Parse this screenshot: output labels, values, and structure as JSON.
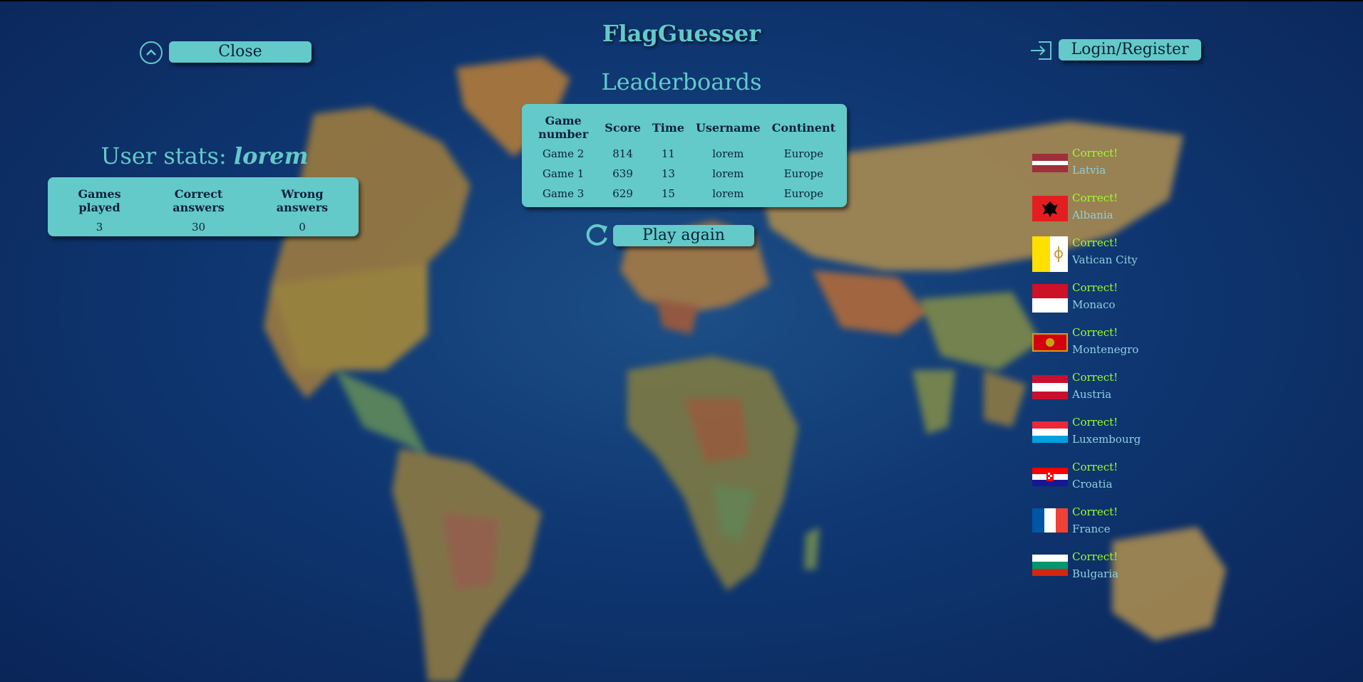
{
  "app": {
    "title": "FlagGuesser"
  },
  "header": {
    "close_label": "Close",
    "login_label": "Login/Register"
  },
  "leaderboards": {
    "title": "Leaderboards",
    "columns": [
      "Game number",
      "Score",
      "Time",
      "Username",
      "Continent"
    ],
    "rows": [
      [
        "Game 2",
        "814",
        "11",
        "lorem",
        "Europe"
      ],
      [
        "Game 1",
        "639",
        "13",
        "lorem",
        "Europe"
      ],
      [
        "Game 3",
        "629",
        "15",
        "lorem",
        "Europe"
      ]
    ]
  },
  "play_again_label": "Play again",
  "user_stats": {
    "title_prefix": "User stats:",
    "username": "lorem",
    "columns": [
      "Games played",
      "Correct answers",
      "Wrong answers"
    ],
    "values": [
      "3",
      "30",
      "0"
    ]
  },
  "results": [
    {
      "status": "Correct!",
      "country": "Latvia",
      "flag_icon": "latvia-flag-icon"
    },
    {
      "status": "Correct!",
      "country": "Albania",
      "flag_icon": "albania-flag-icon"
    },
    {
      "status": "Correct!",
      "country": "Vatican City",
      "flag_icon": "vatican-flag-icon"
    },
    {
      "status": "Correct!",
      "country": "Monaco",
      "flag_icon": "monaco-flag-icon"
    },
    {
      "status": "Correct!",
      "country": "Montenegro",
      "flag_icon": "montenegro-flag-icon"
    },
    {
      "status": "Correct!",
      "country": "Austria",
      "flag_icon": "austria-flag-icon"
    },
    {
      "status": "Correct!",
      "country": "Luxembourg",
      "flag_icon": "luxembourg-flag-icon"
    },
    {
      "status": "Correct!",
      "country": "Croatia",
      "flag_icon": "croatia-flag-icon"
    },
    {
      "status": "Correct!",
      "country": "France",
      "flag_icon": "france-flag-icon"
    },
    {
      "status": "Correct!",
      "country": "Bulgaria",
      "flag_icon": "bulgaria-flag-icon"
    }
  ],
  "colors": {
    "accent": "#63c9c9",
    "correct": "#9cff2a",
    "background": "#0f3772"
  }
}
